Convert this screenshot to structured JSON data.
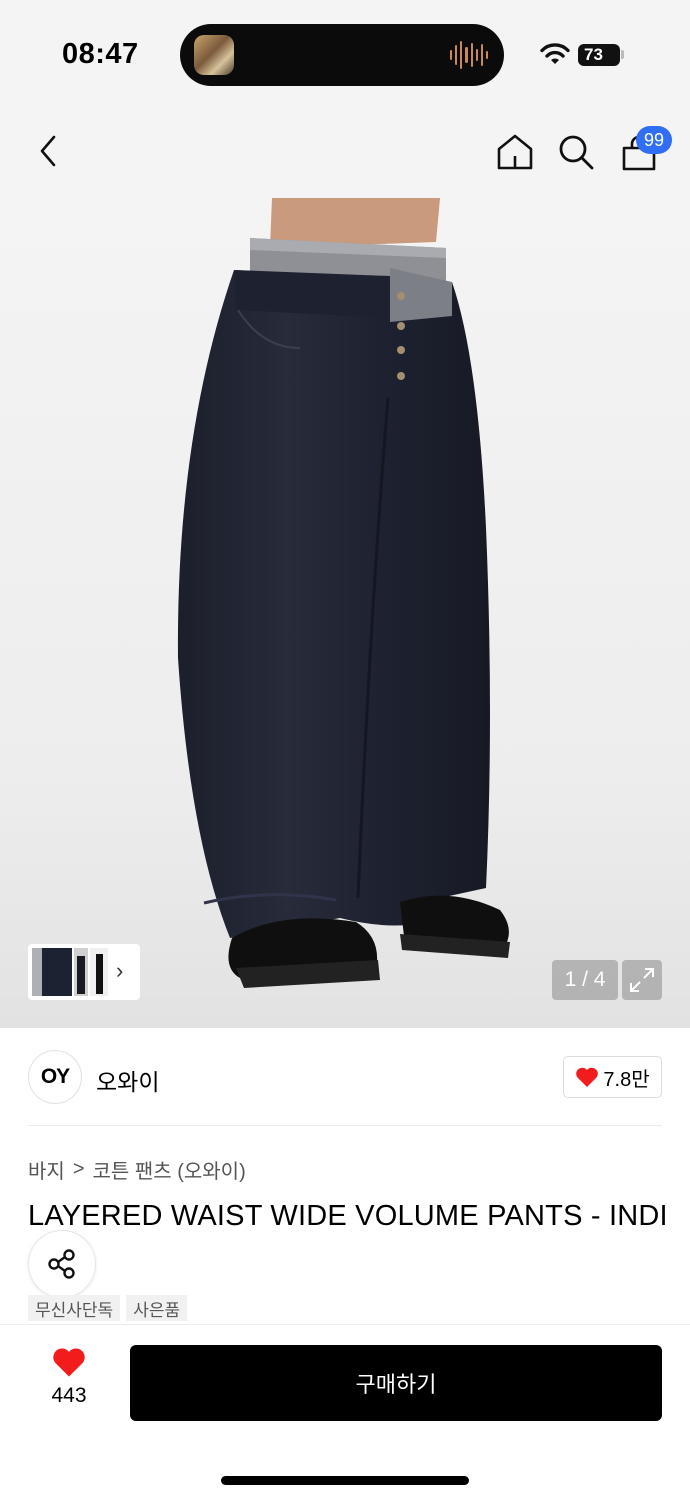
{
  "status_bar": {
    "time": "08:47",
    "battery": "73",
    "icons": [
      "island-avatar",
      "audio-wave-icon",
      "wifi-icon",
      "battery-icon"
    ]
  },
  "nav": {
    "back_icon": "chevron-left-icon",
    "home_icon": "home-icon",
    "search_icon": "search-icon",
    "cart_icon": "shopping-bag-icon",
    "cart_badge": "99",
    "badge_color": "#2f6ef5"
  },
  "gallery": {
    "counter": "1 / 4",
    "current_index": 1,
    "total": 4,
    "expand_icon": "expand-icon"
  },
  "brand": {
    "logo_text": "OY",
    "name": "오와이",
    "likes": "7.8만",
    "heart_color": "#f21c1c"
  },
  "breadcrumb": {
    "category": "바지",
    "separator": ">",
    "subcategory": "코튼 팬츠 (오와이)"
  },
  "product": {
    "title": "LAYERED WAIST WIDE VOLUME PANTS - INDIGO",
    "tags": [
      "무신사단독",
      "사은품"
    ]
  },
  "bottom_bar": {
    "like_count": "443",
    "buy_label": "구매하기",
    "button_color": "#000000"
  }
}
